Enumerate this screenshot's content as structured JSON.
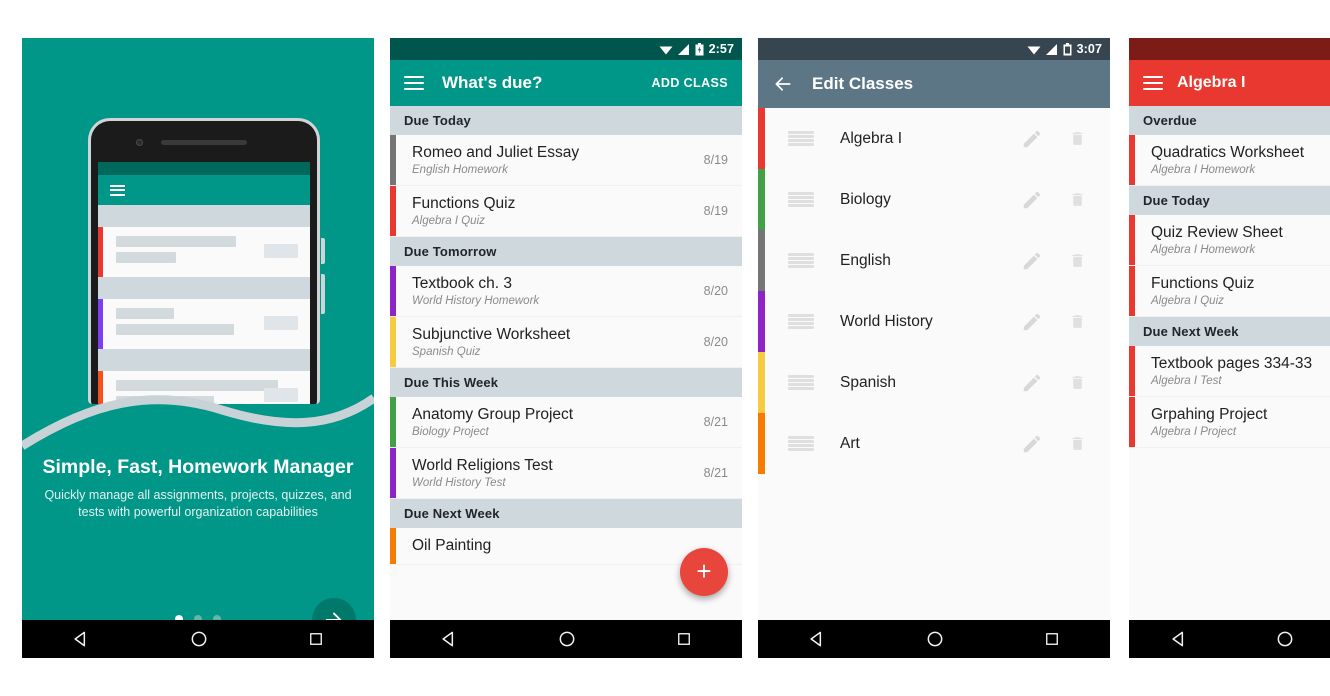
{
  "panels": {
    "onboarding": {
      "name": "onboarding-screen",
      "title": "Simple, Fast, Homework Manager",
      "subtitle": "Quickly manage all assignments, projects, quizzes, and tests with powerful organization capabilities",
      "accent_color": "#009688",
      "next_icon": "arrow-right-icon",
      "page_dots": {
        "total": 3,
        "active_index": 0
      },
      "mock_stripes": [
        "#e8382f",
        "#7e3ff2",
        "#f4511e"
      ]
    },
    "whats_due": {
      "statusbar": {
        "time": "2:57",
        "wifi": "wifi-icon",
        "signal": "signal-icon",
        "battery": "battery-charging-icon"
      },
      "appbar": {
        "menu_icon": "hamburger-icon",
        "title": "What's due?",
        "action_label": "ADD CLASS"
      },
      "fab_icon": "plus-icon",
      "fab_color": "#e8453c",
      "sections": [
        {
          "header": "Due Today",
          "items": [
            {
              "title": "Romeo and Juliet Essay",
              "subtitle": "English Homework",
              "date": "8/19",
              "color": "#757575"
            },
            {
              "title": "Functions Quiz",
              "subtitle": "Algebra I Quiz",
              "date": "8/19",
              "color": "#e8382f"
            }
          ]
        },
        {
          "header": "Due Tomorrow",
          "items": [
            {
              "title": "Textbook ch. 3",
              "subtitle": "World History Homework",
              "date": "8/20",
              "color": "#8e24c4"
            },
            {
              "title": "Subjunctive Worksheet",
              "subtitle": "Spanish Quiz",
              "date": "8/20",
              "color": "#f6cb3f"
            }
          ]
        },
        {
          "header": "Due This Week",
          "items": [
            {
              "title": "Anatomy Group Project",
              "subtitle": "Biology Project",
              "date": "8/21",
              "color": "#43a047"
            },
            {
              "title": "World Religions Test",
              "subtitle": "World History Test",
              "date": "8/21",
              "color": "#8e24c4"
            }
          ]
        },
        {
          "header": "Due Next Week",
          "items": [
            {
              "title": "Oil Painting",
              "subtitle": "",
              "date": "",
              "color": "#f57c00"
            }
          ]
        }
      ]
    },
    "edit_classes": {
      "statusbar": {
        "time": "3:07",
        "wifi": "wifi-icon",
        "signal": "signal-icon",
        "battery": "battery-icon"
      },
      "appbar": {
        "back_icon": "back-arrow-icon",
        "title": "Edit Classes"
      },
      "row_icons": {
        "drag": "drag-handle-icon",
        "edit": "pencil-icon",
        "delete": "trash-icon"
      },
      "classes": [
        {
          "name": "Algebra I",
          "color": "#e8382f"
        },
        {
          "name": "Biology",
          "color": "#43a047"
        },
        {
          "name": "English",
          "color": "#757575"
        },
        {
          "name": "World History",
          "color": "#8e24c4"
        },
        {
          "name": "Spanish",
          "color": "#f6cb3f"
        },
        {
          "name": "Art",
          "color": "#f57c00"
        }
      ]
    },
    "class_detail": {
      "appbar": {
        "menu_icon": "hamburger-icon",
        "title": "Algebra I"
      },
      "accent_color": "#e8382f",
      "sections": [
        {
          "header": "Overdue",
          "items": [
            {
              "title": "Quadratics Worksheet",
              "subtitle": "Algebra I Homework",
              "color": "#e8382f"
            }
          ]
        },
        {
          "header": "Due Today",
          "items": [
            {
              "title": "Quiz Review Sheet",
              "subtitle": "Algebra I Homework",
              "color": "#e8382f"
            },
            {
              "title": "Functions Quiz",
              "subtitle": "Algebra I Quiz",
              "color": "#e8382f"
            }
          ]
        },
        {
          "header": "Due Next Week",
          "items": [
            {
              "title": "Textbook pages 334-33",
              "subtitle": "Algebra I Test",
              "color": "#e8382f"
            },
            {
              "title": "Grpahing Project",
              "subtitle": "Algebra I Project",
              "color": "#e8382f"
            }
          ]
        }
      ]
    }
  },
  "navbar": {
    "back": "back-triangle-icon",
    "home": "home-circle-icon",
    "recents": "recents-square-icon"
  }
}
